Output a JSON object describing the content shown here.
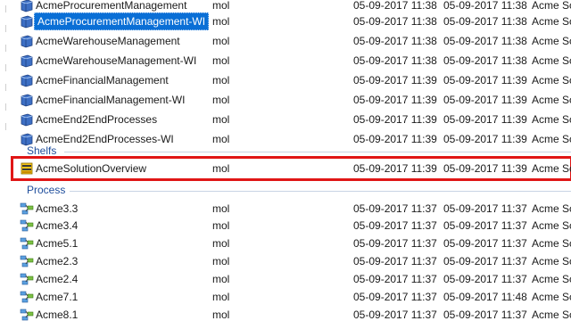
{
  "icons": {
    "book": "blue-book-icon",
    "shelf": "yellow-shelf-icon",
    "process": "process-flow-icon"
  },
  "colors": {
    "selection": "#0a6fd6",
    "highlight_border": "#e01616",
    "group_header": "#1f4e9c"
  },
  "books": [
    {
      "name": "AcmeProcurementManagement",
      "owner": "mol",
      "created": "05-09-2017 11:38",
      "modified": "05-09-2017 11:38",
      "library": "Acme Sc"
    },
    {
      "name": "AcmeProcurementManagement-WI",
      "owner": "mol",
      "created": "05-09-2017 11:38",
      "modified": "05-09-2017 11:38",
      "library": "Acme Sc"
    },
    {
      "name": "AcmeWarehouseManagement",
      "owner": "mol",
      "created": "05-09-2017 11:38",
      "modified": "05-09-2017 11:38",
      "library": "Acme Sc"
    },
    {
      "name": "AcmeWarehouseManagement-WI",
      "owner": "mol",
      "created": "05-09-2017 11:38",
      "modified": "05-09-2017 11:38",
      "library": "Acme Sc"
    },
    {
      "name": "AcmeFinancialManagement",
      "owner": "mol",
      "created": "05-09-2017 11:39",
      "modified": "05-09-2017 11:39",
      "library": "Acme Sc"
    },
    {
      "name": "AcmeFinancialManagement-WI",
      "owner": "mol",
      "created": "05-09-2017 11:39",
      "modified": "05-09-2017 11:39",
      "library": "Acme Sc"
    },
    {
      "name": "AcmeEnd2EndProcesses",
      "owner": "mol",
      "created": "05-09-2017 11:39",
      "modified": "05-09-2017 11:39",
      "library": "Acme Sc"
    },
    {
      "name": "AcmeEnd2EndProcesses-WI",
      "owner": "mol",
      "created": "05-09-2017 11:39",
      "modified": "05-09-2017 11:39",
      "library": "Acme Sc"
    }
  ],
  "shelfs_group": {
    "label": "Shelfs",
    "items": [
      {
        "name": "AcmeSolutionOverview",
        "owner": "mol",
        "created": "05-09-2017 11:39",
        "modified": "05-09-2017 11:39",
        "library": "Acme Sc"
      }
    ]
  },
  "process_group": {
    "label": "Process",
    "items": [
      {
        "name": "Acme3.3",
        "owner": "mol",
        "created": "05-09-2017 11:37",
        "modified": "05-09-2017 11:37",
        "library": "Acme Sc"
      },
      {
        "name": "Acme3.4",
        "owner": "mol",
        "created": "05-09-2017 11:37",
        "modified": "05-09-2017 11:37",
        "library": "Acme Sc"
      },
      {
        "name": "Acme5.1",
        "owner": "mol",
        "created": "05-09-2017 11:37",
        "modified": "05-09-2017 11:37",
        "library": "Acme Sc"
      },
      {
        "name": "Acme2.3",
        "owner": "mol",
        "created": "05-09-2017 11:37",
        "modified": "05-09-2017 11:37",
        "library": "Acme Sc"
      },
      {
        "name": "Acme2.4",
        "owner": "mol",
        "created": "05-09-2017 11:37",
        "modified": "05-09-2017 11:37",
        "library": "Acme Sc"
      },
      {
        "name": "Acme7.1",
        "owner": "mol",
        "created": "05-09-2017 11:37",
        "modified": "05-09-2017 11:48",
        "library": "Acme Sc"
      },
      {
        "name": "Acme8.1",
        "owner": "mol",
        "created": "05-09-2017 11:37",
        "modified": "05-09-2017 11:37",
        "library": "Acme Sc"
      }
    ]
  }
}
